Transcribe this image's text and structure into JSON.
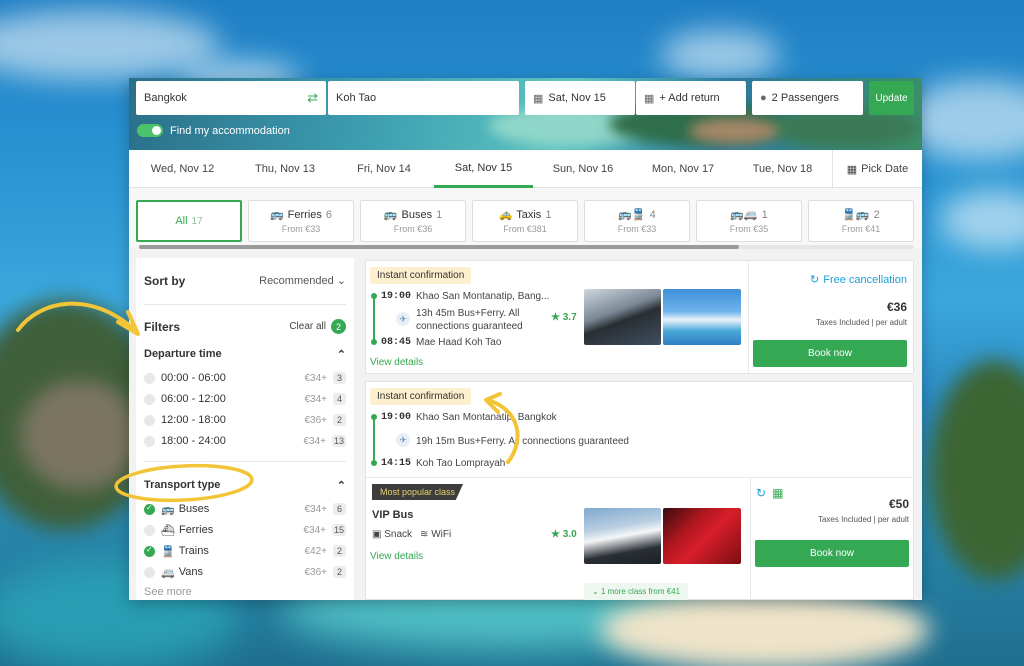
{
  "search": {
    "from": "Bangkok",
    "to": "Koh Tao",
    "date": "Sat, Nov 15",
    "return": "+ Add return",
    "passengers": "2 Passengers",
    "update": "Update",
    "accommodation": "Find my accommodation"
  },
  "dates": [
    "Wed, Nov 12",
    "Thu, Nov 13",
    "Fri, Nov 14",
    "Sat, Nov 15",
    "Sun, Nov 16",
    "Mon, Nov 17",
    "Tue, Nov 18"
  ],
  "pick_date": "Pick Date",
  "transport_tabs": {
    "all": {
      "label": "All",
      "count": "17"
    },
    "ferries": {
      "label": "Ferries",
      "count": "6",
      "from": "From €33"
    },
    "buses": {
      "label": "Buses",
      "count": "1",
      "from": "From €36"
    },
    "taxis": {
      "label": "Taxis",
      "count": "1",
      "from": "From €381"
    },
    "bus_train": {
      "count": "4",
      "from": "From €33"
    },
    "bus_van": {
      "count": "1",
      "from": "From €35"
    },
    "bus_train_2": {
      "count": "2",
      "from": "From €41"
    }
  },
  "sidebar": {
    "sort_label": "Sort by",
    "sort_value": "Recommended",
    "filters_label": "Filters",
    "clear_all": "Clear all",
    "clear_count": "2",
    "departure_title": "Departure time",
    "departure": [
      {
        "label": "00:00 - 06:00",
        "price": "€34+",
        "count": "3"
      },
      {
        "label": "06:00 - 12:00",
        "price": "€34+",
        "count": "4"
      },
      {
        "label": "12:00 - 18:00",
        "price": "€36+",
        "count": "2"
      },
      {
        "label": "18:00 - 24:00",
        "price": "€34+",
        "count": "13"
      }
    ],
    "transport_title": "Transport type",
    "transport": [
      {
        "label": "Buses",
        "price": "€34+",
        "count": "6",
        "checked": true
      },
      {
        "label": "Ferries",
        "price": "€34+",
        "count": "15",
        "checked": false
      },
      {
        "label": "Trains",
        "price": "€42+",
        "count": "2",
        "checked": true
      },
      {
        "label": "Vans",
        "price": "€36+",
        "count": "2",
        "checked": false
      }
    ],
    "see_more": "See more"
  },
  "results": [
    {
      "chip": "Instant confirmation",
      "dep_time": "19:00",
      "dep_place": "Khao San Montanatip, Bang...",
      "duration": "13h 45m Bus+Ferry. All connections guaranteed",
      "duration_l1": "13h 45m Bus+Ferry. All",
      "duration_l2": "connections guaranteed",
      "rating": "3.7",
      "arr_time": "08:45",
      "arr_place": "Mae Haad Koh Tao",
      "details": "View details",
      "free_cancel": "Free cancellation",
      "price": "€36",
      "taxes": "Taxes Included | per adult",
      "book": "Book now"
    },
    {
      "chip": "Instant confirmation",
      "dep_time": "19:00",
      "dep_place": "Khao San Montanatip, Bangkok",
      "duration": "19h 15m Bus+Ferry. All connections guaranteed",
      "arr_time": "14:15",
      "arr_place": "Koh Tao Lomprayah",
      "popular": "Most popular class",
      "class_name": "VIP Bus",
      "amen_snack": "Snack",
      "amen_wifi": "WiFi",
      "rating": "3.0",
      "details": "View details",
      "price": "€50",
      "taxes": "Taxes Included | per adult",
      "book": "Book now",
      "more_class": "1 more class from €41"
    }
  ],
  "colors": {
    "accent": "#35a853",
    "chip": "#fdf0cf",
    "annotation": "#f2c437",
    "cancel": "#1aa0d6"
  }
}
